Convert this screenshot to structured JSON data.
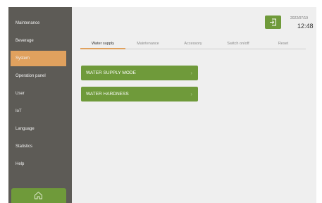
{
  "sidebar": {
    "items": [
      {
        "label": "Maintenance"
      },
      {
        "label": "Beverage"
      },
      {
        "label": "System",
        "active": true
      },
      {
        "label": "Operation panel"
      },
      {
        "label": "User"
      },
      {
        "label": "IoT"
      },
      {
        "label": "Language"
      },
      {
        "label": "Statistics"
      },
      {
        "label": "Help"
      }
    ],
    "home_icon": "home-icon"
  },
  "header": {
    "date": "2022/07/19",
    "time": "12:48",
    "exit_icon": "logout-icon"
  },
  "tabs": [
    {
      "label": "Water supply",
      "active": true
    },
    {
      "label": "Maintenance"
    },
    {
      "label": "Accessory"
    },
    {
      "label": "Switch on/off"
    },
    {
      "label": "Reset"
    }
  ],
  "main": {
    "buttons": [
      {
        "label": "WATER SUPPLY MODE"
      },
      {
        "label": "WATER HARDNESS"
      }
    ]
  },
  "colors": {
    "sidebar_bg": "#5d5b56",
    "accent_orange": "#e0a15e",
    "accent_green": "#6f9a3a",
    "content_bg": "#efefef"
  }
}
